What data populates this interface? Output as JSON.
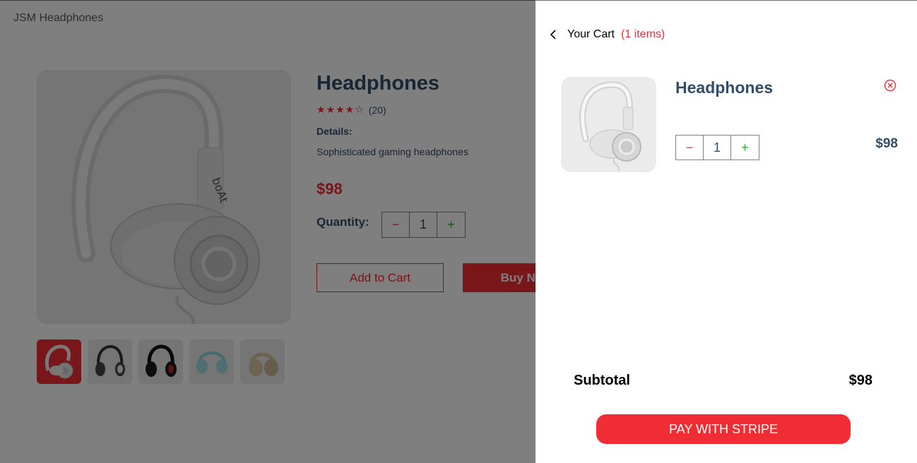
{
  "header": {
    "logo": "JSM Headphones"
  },
  "product": {
    "title": "Headphones",
    "stars": "★★★★☆",
    "reviews": "(20)",
    "details_heading": "Details:",
    "details": "Sophisticated gaming headphones",
    "price": "$98",
    "quantity_label": "Quantity:",
    "quantity": "1",
    "minus": "−",
    "plus": "+",
    "add_to_cart": "Add to Cart",
    "buy_now": "Buy Now",
    "selected_thumbnail": 1,
    "thumbnail_count": 5
  },
  "cart": {
    "heading": "Your Cart",
    "count": "(1 items)",
    "items": [
      {
        "title": "Headphones",
        "quantity": "1",
        "price": "$98"
      }
    ],
    "minus": "−",
    "plus": "+",
    "subtotal_label": "Subtotal",
    "subtotal_value": "$98",
    "pay_button": "PAY WITH STRIPE"
  },
  "colors": {
    "accent": "#f02d34",
    "text_primary": "#324d67",
    "plus_green": "#31a831",
    "image_bg": "#ebebeb"
  },
  "icons": {
    "back": "chevron-left-icon",
    "remove": "close-circle-icon",
    "rating": "star-icon"
  }
}
